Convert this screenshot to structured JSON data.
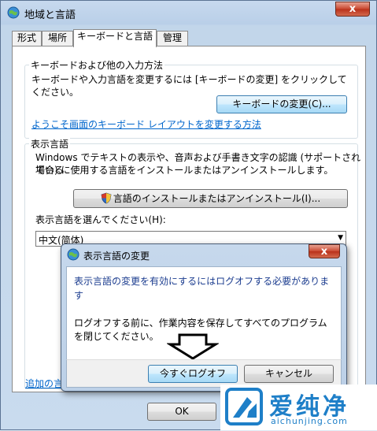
{
  "window": {
    "title": "地域と言語",
    "close_glyph": "x"
  },
  "tabs": [
    {
      "label": "形式"
    },
    {
      "label": "場所"
    },
    {
      "label": "キーボードと言語"
    },
    {
      "label": "管理"
    }
  ],
  "keyboard_group": {
    "title": "キーボードおよび他の入力方法",
    "description": "キーボードや入力言語を変更するには [キーボードの変更] をクリックしてください。",
    "change_button": "キーボードの変更(C)...",
    "link": "ようこそ画面のキーボード レイアウトを変更する方法"
  },
  "display_group": {
    "title": "表示言語",
    "description_line1": "Windows でテキストの表示や、音声および手書き文字の認識 (サポートされている",
    "description_line2": "場合) に使用する言語をインストールまたはアンインストールします。",
    "install_button": "言語のインストールまたはアンインストール(I)...",
    "select_label": "表示言語を選んでください(H):",
    "select_value": "中文(简体)",
    "bottom_link": "追加の言"
  },
  "dialog": {
    "title": "表示言語の変更",
    "close_glyph": "x",
    "message1_line1": "表示言語の変更を有効にするにはログオフする必要がありま",
    "message1_line2": "す",
    "message2_line1": "ログオフする前に、作業内容を保存してすべてのプログラム",
    "message2_line2": "を閉じてください。",
    "logoff_button": "今すぐログオフ",
    "cancel_button": "キャンセル"
  },
  "footer": {
    "ok_button": "OK"
  },
  "watermark": {
    "brand": "爱纯净",
    "url": "aichunjing.com"
  },
  "colors": {
    "link": "#0066cc",
    "dialog_text": "#1b3c8f",
    "close_red": "#c9472f",
    "watermark_blue": "#1e7fc8"
  }
}
